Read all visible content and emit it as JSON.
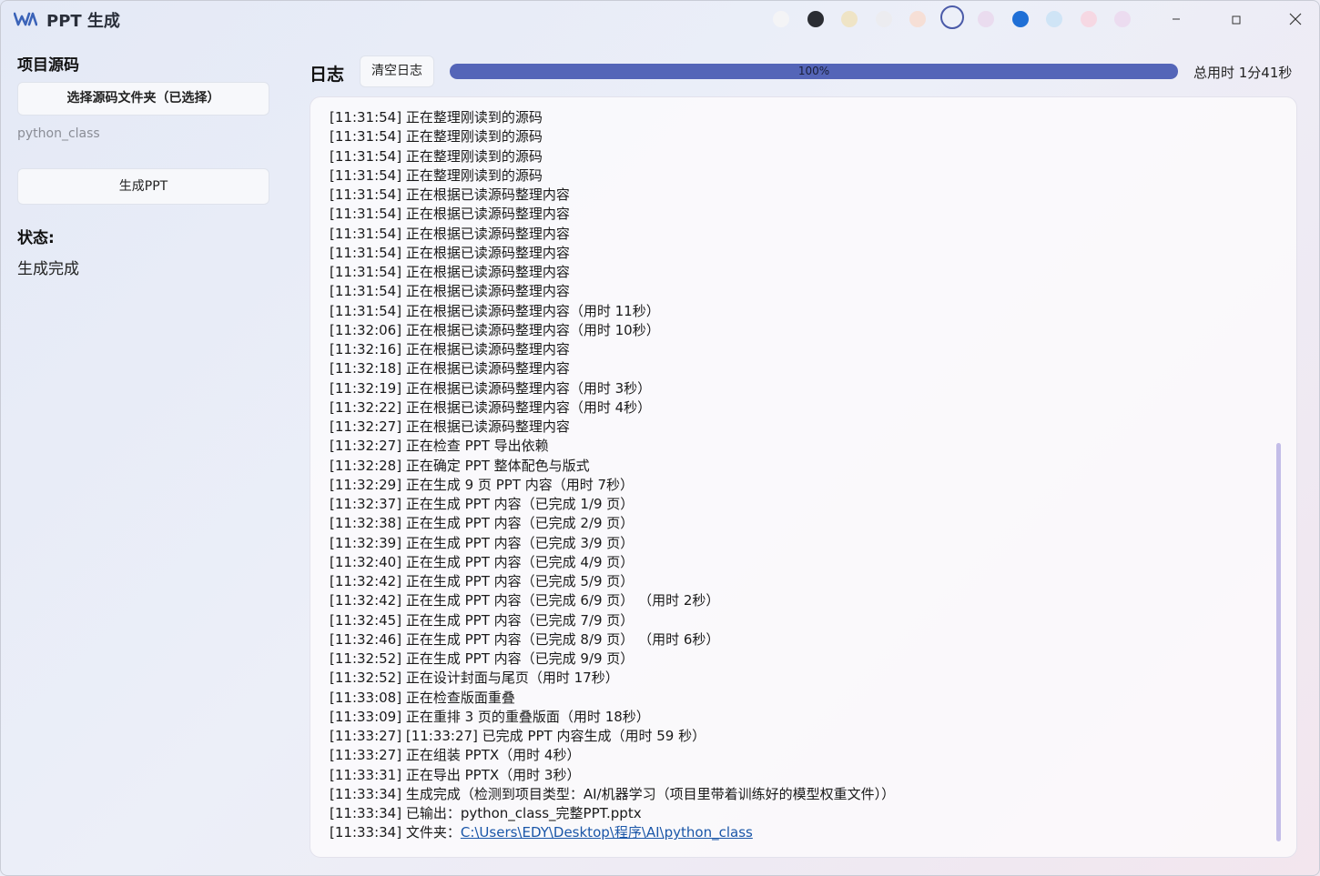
{
  "window": {
    "title": "PPT 生成",
    "theme_swatches": [
      {
        "name": "swatch-white",
        "color": "#f4f4f6"
      },
      {
        "name": "swatch-black",
        "color": "#2b2d33"
      },
      {
        "name": "swatch-cream",
        "color": "#efe4c6"
      },
      {
        "name": "swatch-light-gray",
        "color": "#ececf0"
      },
      {
        "name": "swatch-peach",
        "color": "#f6dfd6"
      },
      {
        "name": "swatch-selected-ring",
        "color": "#4a5aa8",
        "selected": true
      },
      {
        "name": "swatch-lilac",
        "color": "#eadcef"
      },
      {
        "name": "swatch-blue",
        "color": "#1f6fd6"
      },
      {
        "name": "swatch-sky",
        "color": "#cfe4f6"
      },
      {
        "name": "swatch-pink",
        "color": "#f6d8e3"
      },
      {
        "name": "swatch-lavender",
        "color": "#ecdcf0"
      }
    ],
    "accent_color": "#5465b8"
  },
  "sidebar": {
    "project_heading": "项目源码",
    "select_folder_label": "选择源码文件夹（已选择）",
    "folder_name": "python_class",
    "generate_label": "生成PPT",
    "status_heading": "状态:",
    "status_value": "生成完成"
  },
  "main": {
    "log_heading": "日志",
    "clear_log_label": "清空日志",
    "progress_percent": 100,
    "progress_label": "100%",
    "elapsed_label": "总用时 1分41秒"
  },
  "log_lines": [
    "[11:31:54] 正在整理刚读到的源码",
    "[11:31:54] 正在整理刚读到的源码",
    "[11:31:54] 正在整理刚读到的源码",
    "[11:31:54] 正在整理刚读到的源码",
    "[11:31:54] 正在根据已读源码整理内容",
    "[11:31:54] 正在根据已读源码整理内容",
    "[11:31:54] 正在根据已读源码整理内容",
    "[11:31:54] 正在根据已读源码整理内容",
    "[11:31:54] 正在根据已读源码整理内容",
    "[11:31:54] 正在根据已读源码整理内容",
    "[11:31:54] 正在根据已读源码整理内容（用时 11秒）",
    "[11:32:06] 正在根据已读源码整理内容（用时 10秒）",
    "[11:32:16] 正在根据已读源码整理内容",
    "[11:32:18] 正在根据已读源码整理内容",
    "[11:32:19] 正在根据已读源码整理内容（用时 3秒）",
    "[11:32:22] 正在根据已读源码整理内容（用时 4秒）",
    "[11:32:27] 正在根据已读源码整理内容",
    "[11:32:27] 正在检查 PPT 导出依赖",
    "[11:32:28] 正在确定 PPT 整体配色与版式",
    "[11:32:29] 正在生成 9 页 PPT 内容（用时 7秒）",
    "[11:32:37] 正在生成 PPT 内容（已完成 1/9 页）",
    "[11:32:38] 正在生成 PPT 内容（已完成 2/9 页）",
    "[11:32:39] 正在生成 PPT 内容（已完成 3/9 页）",
    "[11:32:40] 正在生成 PPT 内容（已完成 4/9 页）",
    "[11:32:42] 正在生成 PPT 内容（已完成 5/9 页）",
    "[11:32:42] 正在生成 PPT 内容（已完成 6/9 页） （用时 2秒）",
    "[11:32:45] 正在生成 PPT 内容（已完成 7/9 页）",
    "[11:32:46] 正在生成 PPT 内容（已完成 8/9 页） （用时 6秒）",
    "[11:32:52] 正在生成 PPT 内容（已完成 9/9 页）",
    "[11:32:52] 正在设计封面与尾页（用时 17秒）",
    "[11:33:08] 正在检查版面重叠",
    "[11:33:09] 正在重排 3 页的重叠版面（用时 18秒）",
    "[11:33:27] [11:33:27] 已完成 PPT 内容生成（用时 59 秒）",
    "[11:33:27] 正在组装 PPTX（用时 4秒）",
    "[11:33:31] 正在导出 PPTX（用时 3秒）",
    "[11:33:34] 生成完成（检测到项目类型：AI/机器学习（项目里带着训练好的模型权重文件））",
    "[11:33:34] 已输出：python_class_完整PPT.pptx"
  ],
  "folder_line": {
    "prefix": "[11:33:34] 文件夹：",
    "path": "C:\\Users\\EDY\\Desktop\\程序\\AI\\python_class"
  }
}
